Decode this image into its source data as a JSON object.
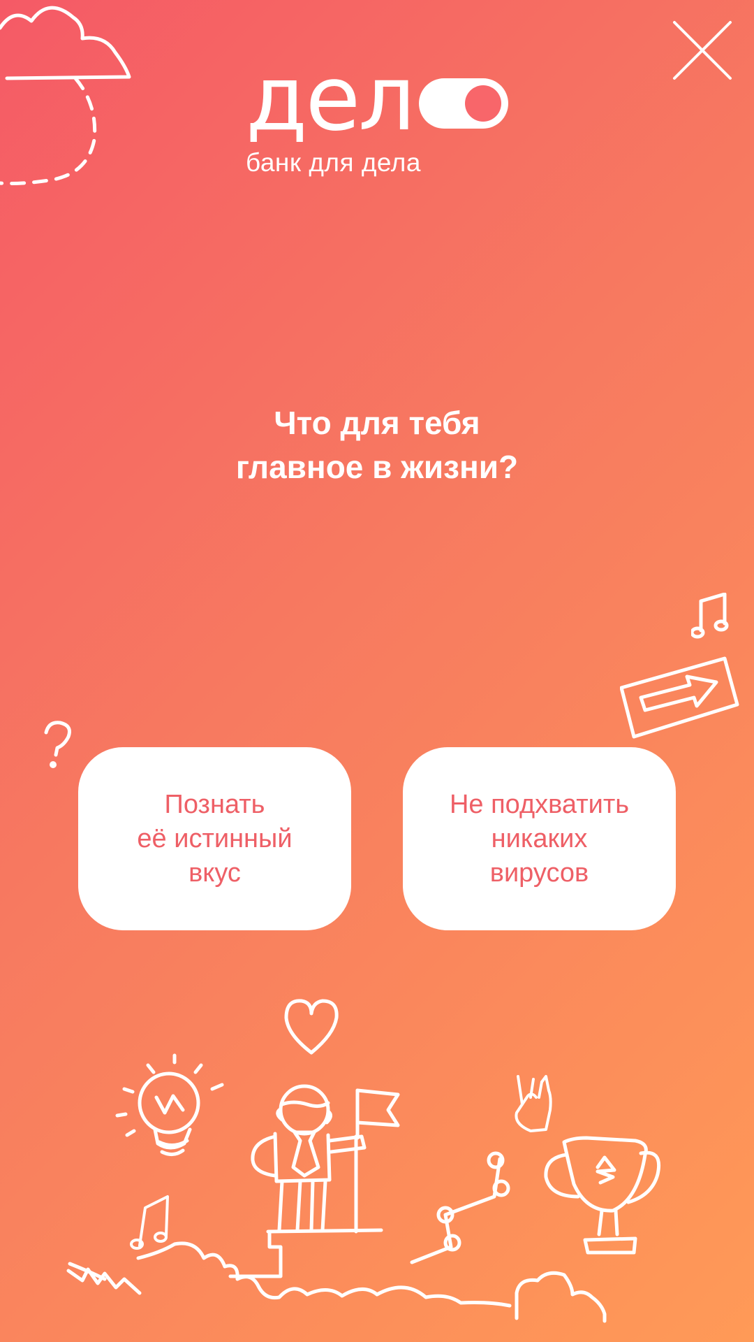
{
  "logo": {
    "wordmark": "дел",
    "tagline": "банк для дела"
  },
  "question": {
    "line1": "Что для тебя",
    "line2": "главное в жизни?"
  },
  "answers": [
    {
      "lines": [
        "Познать",
        "её истинный",
        "вкус"
      ]
    },
    {
      "lines": [
        "Не подхватить",
        "никаких",
        "вирусов"
      ]
    }
  ],
  "icons": [
    "close-icon",
    "cloud-icon",
    "question-mark-icon",
    "music-note-icon",
    "arrow-sign-icon",
    "heart-icon",
    "lightbulb-icon",
    "person-with-flag-icon",
    "rock-hand-icon",
    "graph-icon",
    "trophy-icon"
  ],
  "colors": {
    "gradient_start": "#f55a66",
    "gradient_end": "#ff9a57",
    "button_text": "#ee5f66",
    "button_bg": "#ffffff"
  }
}
